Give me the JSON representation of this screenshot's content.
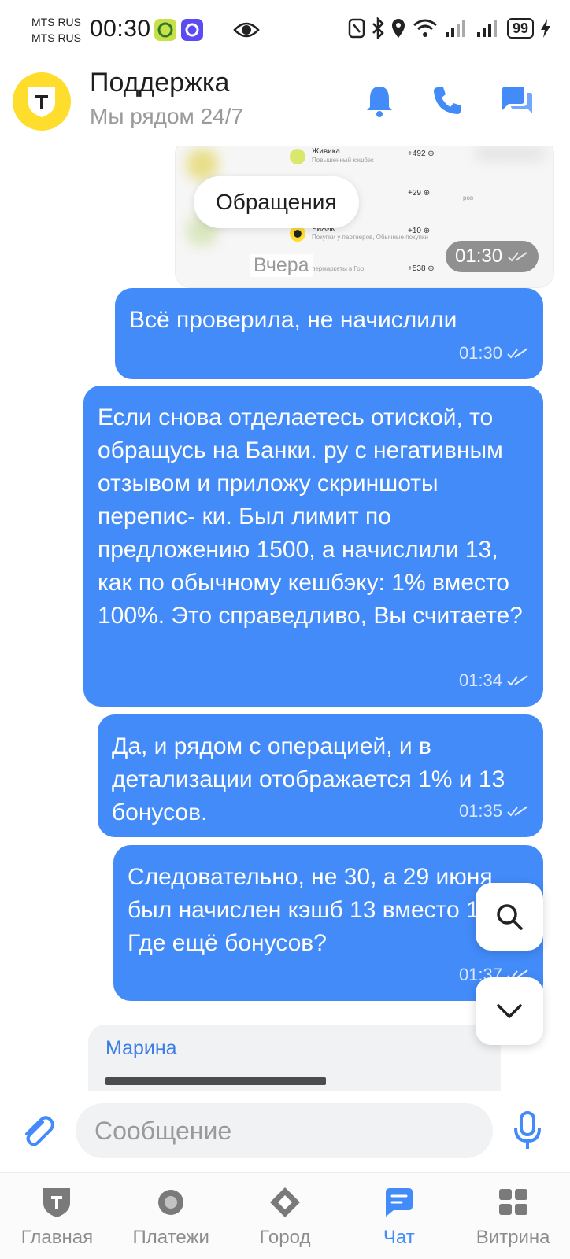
{
  "status_bar": {
    "carrier1": "MTS RUS",
    "carrier2": "MTS RUS",
    "time": "00:30",
    "battery": "99"
  },
  "header": {
    "title": "Поддержка",
    "subtitle": "Мы рядом 24/7",
    "avatar_glyph": "Т"
  },
  "screenshot_preview": {
    "rows": [
      {
        "name": "Живика",
        "sub": "Повышенный кэшбэк",
        "amount": "+492 ⊕"
      },
      {
        "name": "",
        "sub": "ров",
        "amount": "+29 ⊕"
      },
      {
        "name": "Чижик",
        "sub": "Покупки у партнеров, Обычные покупки",
        "amount": "+10 ⊕"
      },
      {
        "name": "",
        "sub": "пермаркеты в Гор",
        "amount": "+538 ⊕"
      }
    ],
    "section_label": "Обращения",
    "time": "01:30",
    "day_label": "Вчера"
  },
  "messages": [
    {
      "text": "Всё проверила, не начислили",
      "time": "01:30"
    },
    {
      "text": "Если снова отделаетесь отиской, то обращусь на Банки. ру с негативным отзывом и приложу скриншоты перепис- ки. Был лимит по предложению 1500, а начислили 13, как по обычному кешбэку: 1% вместо 100%. Это справедливо, Вы считаете?",
      "time": "01:34"
    },
    {
      "text": "Да, и рядом с операцией, и в детализации отображается 1% и 13 бонусов.",
      "time": "01:35"
    },
    {
      "text": "Следовательно, не 30, а 29 июня был начислен кэшб 13 вместо 1326. Где ещё бонусов?",
      "time": "01:37"
    }
  ],
  "incoming": {
    "author": "Марина"
  },
  "composer": {
    "placeholder": "Сообщение"
  },
  "tabs": [
    {
      "label": "Главная",
      "icon": "shield-icon"
    },
    {
      "label": "Платежи",
      "icon": "circle-icon"
    },
    {
      "label": "Город",
      "icon": "diamond-icon"
    },
    {
      "label": "Чат",
      "icon": "chat-icon",
      "active": true
    },
    {
      "label": "Витрина",
      "icon": "grid-icon"
    }
  ],
  "colors": {
    "accent": "#428bf9",
    "brand_yellow": "#ffdd2d"
  }
}
